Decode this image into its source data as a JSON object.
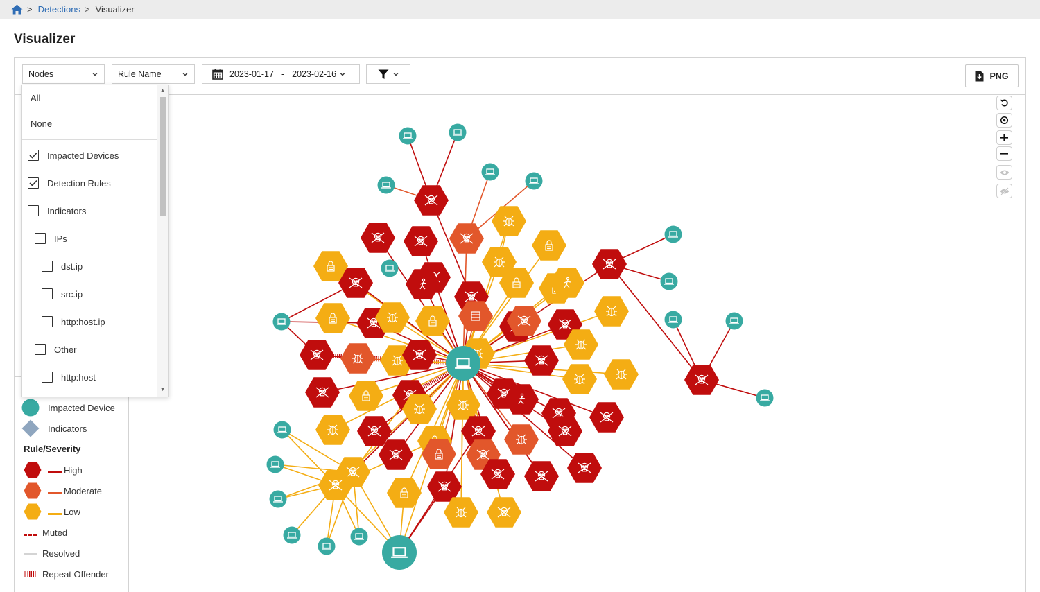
{
  "breadcrumb": {
    "home_icon": "home-icon",
    "items": [
      "Detections",
      "Visualizer"
    ]
  },
  "page": {
    "title": "Visualizer"
  },
  "toolbar": {
    "nodes_label": "Nodes",
    "rule_label": "Rule Name",
    "date_from": "2023-01-17",
    "date_sep": "-",
    "date_to": "2023-02-16",
    "png_label": "PNG"
  },
  "nodes_menu": {
    "all": "All",
    "none": "None",
    "options": [
      {
        "label": "Impacted Devices",
        "checked": true
      },
      {
        "label": "Detection Rules",
        "checked": true
      },
      {
        "label": "Indicators",
        "checked": false
      },
      {
        "label": "IPs",
        "checked": false
      },
      {
        "label": "dst.ip",
        "checked": false
      },
      {
        "label": "src.ip",
        "checked": false
      },
      {
        "label": "http:host.ip",
        "checked": false
      },
      {
        "label": "Other",
        "checked": false
      },
      {
        "label": "http:host",
        "checked": false
      }
    ]
  },
  "legend": {
    "impacted_device": "Impacted Device",
    "indicators": "Indicators",
    "rule_severity": "Rule/Severity",
    "high": "High",
    "moderate": "Moderate",
    "low": "Low",
    "muted": "Muted",
    "resolved": "Resolved",
    "repeat_offender": "Repeat Offender"
  },
  "colors": {
    "high": "#c00d0d",
    "moderate": "#e2572b",
    "low": "#f4ad14",
    "device": "#38aaa2",
    "indicator": "#8fa6bf",
    "link": "#2f6db5"
  },
  "graph_controls": [
    "reset-icon",
    "center-icon",
    "zoom-in-icon",
    "zoom-out-icon",
    "show-icon",
    "hide-icon"
  ]
}
